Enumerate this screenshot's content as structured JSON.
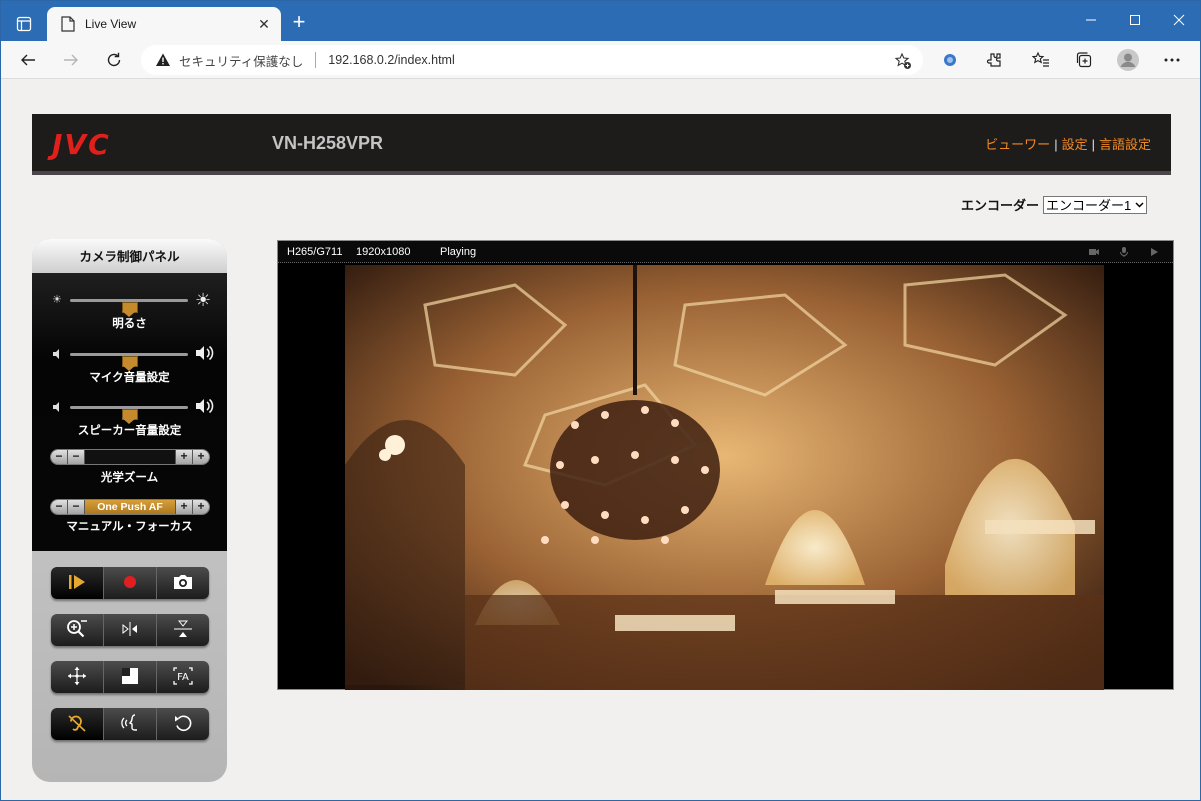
{
  "browser": {
    "tab_title": "Live View",
    "security_label": "セキュリティ保護なし",
    "url": "192.168.0.2/index.html"
  },
  "header": {
    "logo": "JVC",
    "model": "VN-H258VPR",
    "nav": [
      "ビューワー",
      "設定",
      "言語設定"
    ],
    "nav_separator": "|",
    "accent_color": "#f08a24",
    "logo_color": "#e0201a"
  },
  "encoder": {
    "label": "エンコーダー",
    "selected": "エンコーダー1"
  },
  "camera_panel": {
    "title": "カメラ制御パネル",
    "brightness_label": "明るさ",
    "mic_label": "マイク音量設定",
    "speaker_label": "スピーカー音量設定",
    "brightness_level": 0.5,
    "mic_level": 0.5,
    "speaker_level": 0.5,
    "zoom_label": "光学ズーム",
    "focus_label": "マニュアル・フォーカス",
    "focus_button": "One Push AF",
    "minus": "−",
    "plus": "+",
    "buttons": [
      [
        "play-icon",
        "record-icon",
        "snapshot-icon"
      ],
      [
        "digital-zoom-icon",
        "flip-horizontal-icon",
        "flip-vertical-icon"
      ],
      [
        "move-icon",
        "area-icon",
        "face-area-icon"
      ],
      [
        "listen-icon",
        "talk-icon",
        "rotate-icon"
      ]
    ]
  },
  "video": {
    "codec": "H265/G711",
    "resolution": "1920x1080",
    "state": "Playing"
  }
}
